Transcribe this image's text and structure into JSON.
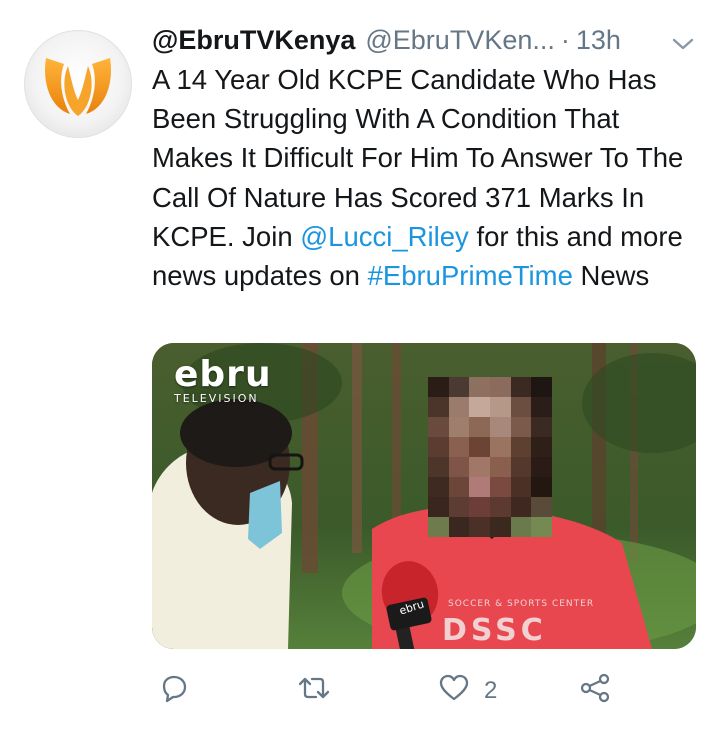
{
  "tweet": {
    "display_name": "@EbruTVKenya",
    "handle": "@EbruTVKen...",
    "separator": "·",
    "time": "13h",
    "text_part1": "A 14 Year Old KCPE Candidate Who Has Been Struggling With A Condition That Makes It Difficult For Him To Answer To The Call Of Nature Has Scored 371 Marks In KCPE. Join ",
    "mention": "@Lucci_Riley",
    "text_part2": " for this and more news updates on ",
    "hashtag": "#EbruPrimeTime",
    "text_part3": " News"
  },
  "media": {
    "logo_word": "ebru",
    "logo_sub": "TELEVISION",
    "mic_label": "ebru",
    "shirt_top": "SOCCER & SPORTS CENTER",
    "shirt_text": "DSSC"
  },
  "actions": {
    "reply_icon": "reply-icon",
    "retweet_icon": "retweet-icon",
    "like_icon": "heart-icon",
    "like_count": "2",
    "share_icon": "share-icon"
  },
  "colors": {
    "link": "#1b95e0",
    "secondary_text": "#657786",
    "avatar_orange": "#f39a1e"
  }
}
